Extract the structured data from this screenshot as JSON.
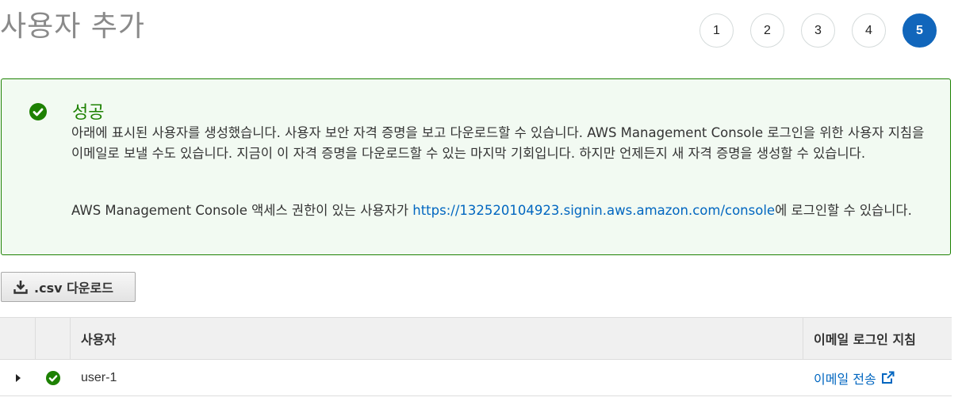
{
  "page": {
    "title": "사용자 추가"
  },
  "steps": [
    "1",
    "2",
    "3",
    "4",
    "5"
  ],
  "alert": {
    "icon": "check-circle-icon",
    "title": "성공",
    "message": "아래에 표시된 사용자를 생성했습니다. 사용자 보안 자격 증명을 보고 다운로드할 수 있습니다. AWS Management Console 로그인을 위한 사용자 지침을 이메일로 보낼 수도 있습니다. 지금이 이 자격 증명을 다운로드할 수 있는 마지막 기회입니다. 하지만 언제든지 새 자격 증명을 생성할 수 있습니다.",
    "console_prefix": "AWS Management Console 액세스 권한이 있는 사용자가 ",
    "console_link": "https://132520104923.signin.aws.amazon.com/console",
    "console_suffix": "에 로그인할 수 있습니다."
  },
  "download_button": {
    "label": ".csv 다운로드",
    "icon": "download-icon"
  },
  "table": {
    "headers": {
      "user": "사용자",
      "email": "이메일 로그인 지침"
    },
    "rows": [
      {
        "user": "user-1",
        "email_link": "이메일 전송",
        "status_icon": "check-circle-icon",
        "link_icon": "external-link-icon"
      }
    ]
  },
  "colors": {
    "success": "#1d8102",
    "accent": "#1166bb",
    "link": "#0066c0"
  }
}
